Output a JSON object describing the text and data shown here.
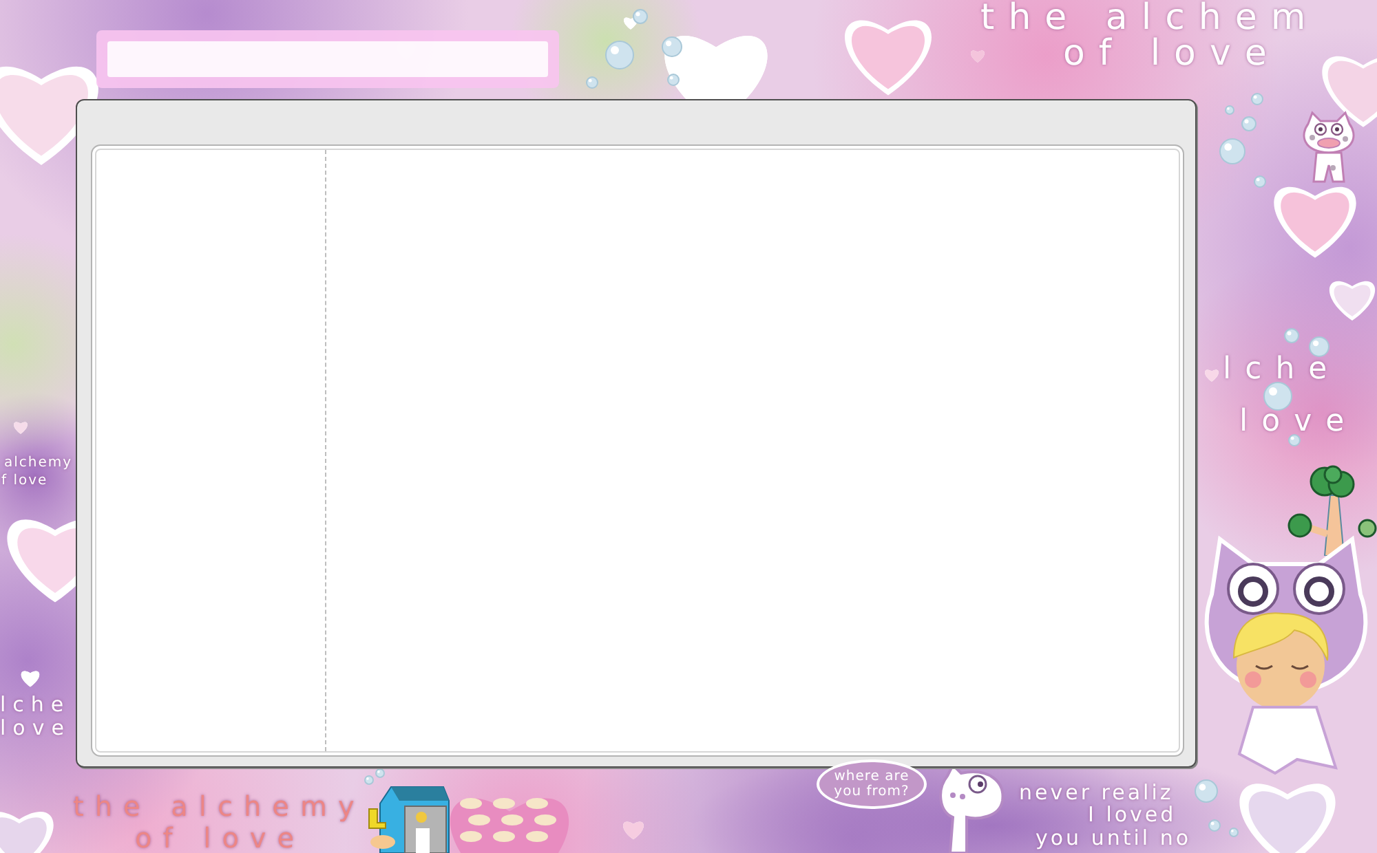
{
  "wallpaper": {
    "captions": [
      {
        "kind": "title",
        "lines": [
          "the alchem",
          "of love"
        ]
      },
      {
        "kind": "large",
        "lines": [
          "lche",
          "love"
        ]
      },
      {
        "kind": "small",
        "lines": [
          "alchemy",
          "f love"
        ]
      },
      {
        "kind": "medium",
        "lines": [
          "lche",
          "love"
        ]
      },
      {
        "kind": "pink",
        "lines": [
          "the alchemy",
          "of love"
        ]
      },
      {
        "kind": "slanted",
        "lines": [
          "never realiz",
          "I loved",
          "you until no"
        ]
      }
    ]
  },
  "speech_bubble": {
    "lines": [
      "where are",
      "you from?"
    ]
  }
}
